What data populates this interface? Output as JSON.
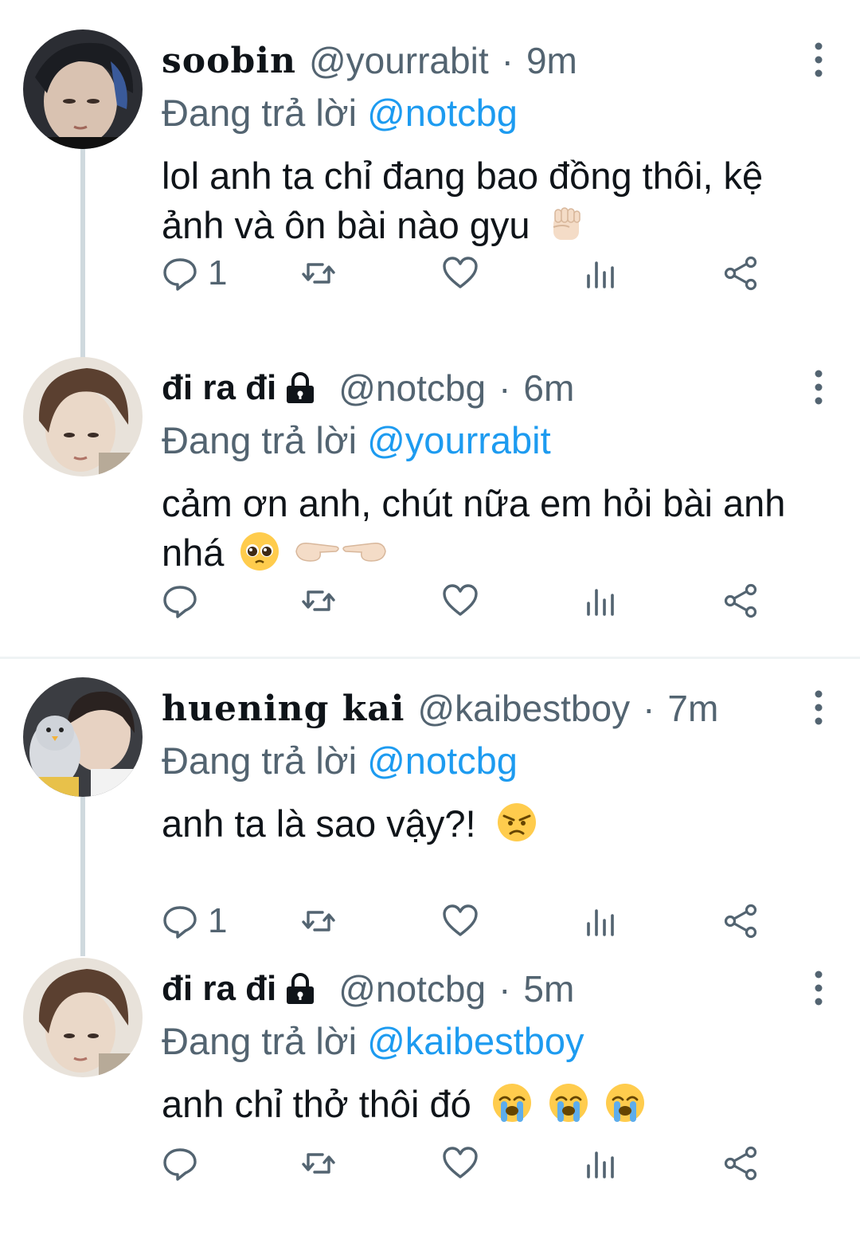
{
  "colors": {
    "text": "#0f1419",
    "secondary": "#536471",
    "link": "#1d9bf0",
    "thread_line": "#cfd9de"
  },
  "reply_prefix": "Đang trả lời",
  "tweets": [
    {
      "name": "soobin",
      "handle": "@yourrabit",
      "dot": "·",
      "time": "9m",
      "reply_to": "@notcbg",
      "text": "lol anh ta chỉ đang bao đồng thôi, kệ ảnh và ôn bài nào gyu",
      "emojis": [
        "raised-fist-icon"
      ],
      "reply_count": "1",
      "locked": false
    },
    {
      "name": "đi ra đi",
      "handle": "@notcbg",
      "dot": "·",
      "time": "6m",
      "reply_to": "@yourrabit",
      "text": "cảm ơn anh, chút nữa em hỏi bài anh nhá",
      "emojis": [
        "pleading-face-icon",
        "pointing-fingers-icon"
      ],
      "reply_count": "",
      "locked": true
    },
    {
      "name": "huening kai",
      "handle": "@kaibestboy",
      "dot": "·",
      "time": "7m",
      "reply_to": "@notcbg",
      "text": "anh ta là sao vậy?!",
      "emojis": [
        "angry-face-icon"
      ],
      "reply_count": "1",
      "locked": false
    },
    {
      "name": "đi ra đi",
      "handle": "@notcbg",
      "dot": "·",
      "time": "5m",
      "reply_to": "@kaibestboy",
      "text": "anh chỉ thở thôi đó",
      "emojis": [
        "crying-face-icon",
        "crying-face-icon",
        "crying-face-icon"
      ],
      "reply_count": "",
      "locked": true
    }
  ]
}
